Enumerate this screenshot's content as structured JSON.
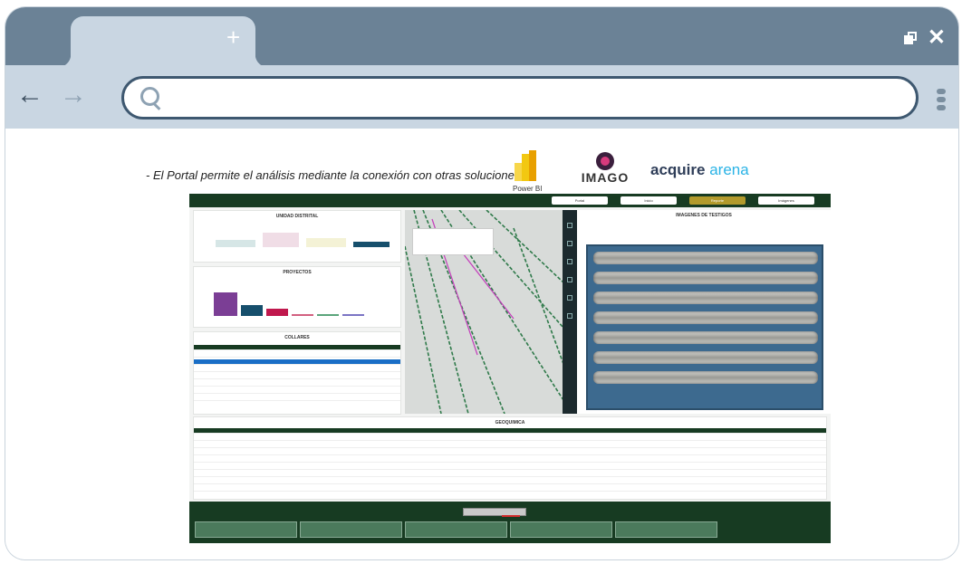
{
  "browser": {
    "new_tab_symbol": "+",
    "close_symbol": "✕",
    "address_value": ""
  },
  "slide": {
    "title": "- El Portal permite el análisis mediante la conexión con otras soluciones",
    "logos": {
      "powerbi_label": "Power BI",
      "imago_label": "IMAGO",
      "acquire_part1": "acquire",
      "acquire_part2": "arena"
    }
  },
  "dashboard": {
    "nav_buttons": [
      "Portal",
      "Inicio",
      "Reporte",
      "Imágenes"
    ],
    "active_button": 2,
    "panels": {
      "unidad": "UNIDAD DISTRITAL",
      "proyectos": "PROYECTOS",
      "collares": "COLLARES",
      "imagenes": "IMAGENES DE TESTIGOS",
      "geoquimica": "GEOQUIMICA"
    },
    "bottom_tabs": [
      "",
      "",
      "",
      "",
      ""
    ]
  },
  "colors": {
    "browser_dark": "#6b8296",
    "browser_light": "#c9d6e2",
    "dashboard_green": "#173b22",
    "accent_gold": "#b29a2c",
    "core_box_blue": "#3d6a8f"
  }
}
